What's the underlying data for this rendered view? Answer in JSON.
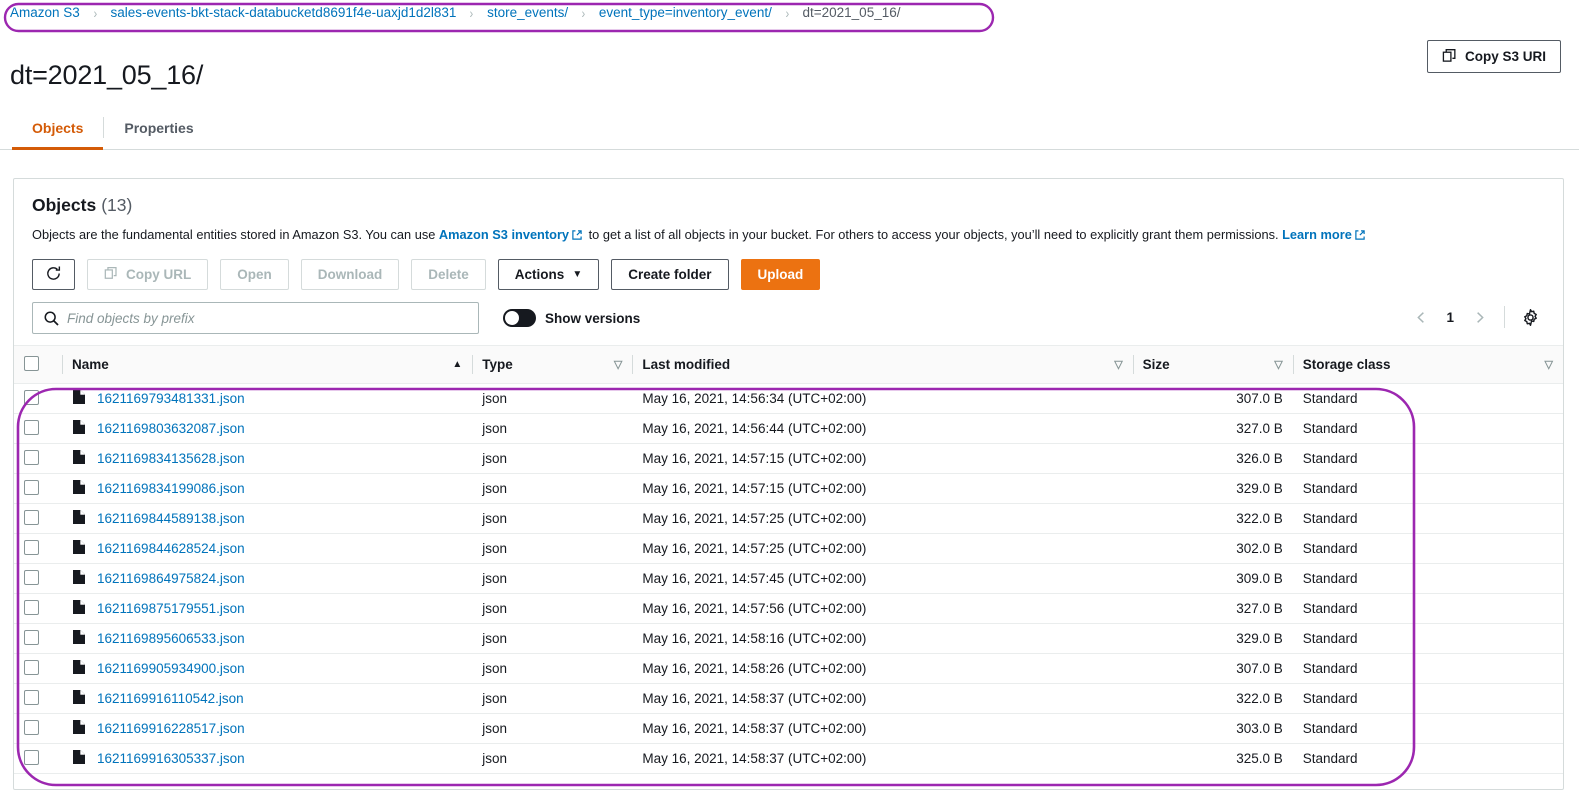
{
  "breadcrumb": {
    "items": [
      {
        "label": "Amazon S3",
        "current": false
      },
      {
        "label": "sales-events-bkt-stack-databucketd8691f4e-uaxjd1d2l831",
        "current": false
      },
      {
        "label": "store_events/",
        "current": false
      },
      {
        "label": "event_type=inventory_event/",
        "current": false
      },
      {
        "label": "dt=2021_05_16/",
        "current": true
      }
    ],
    "separator": "›"
  },
  "header": {
    "title": "dt=2021_05_16/",
    "copy_s3_uri_label": "Copy S3 URI",
    "copy_icon": "copy-icon"
  },
  "tabs": [
    {
      "label": "Objects",
      "active": true
    },
    {
      "label": "Properties",
      "active": false
    }
  ],
  "panel": {
    "title": "Objects",
    "count": "(13)",
    "description_before_link": "Objects are the fundamental entities stored in Amazon S3. You can use ",
    "inventory_link": "Amazon S3 inventory",
    "description_middle": " to get a list of all objects in your bucket. For others to access your objects, you’ll need to explicitly grant them permissions. ",
    "learn_more_link": "Learn more",
    "external_icon": "external-link-icon"
  },
  "toolbar": {
    "refresh_icon": "refresh-icon",
    "copy_url_label": "Copy URL",
    "copy_url_icon": "copy-icon",
    "open_label": "Open",
    "download_label": "Download",
    "delete_label": "Delete",
    "actions_label": "Actions",
    "actions_caret": "▼",
    "create_folder_label": "Create folder",
    "upload_label": "Upload"
  },
  "filter": {
    "search_placeholder": "Find objects by prefix",
    "search_value": "",
    "search_icon": "search-icon",
    "show_versions_label": "Show versions",
    "show_versions_on": false
  },
  "pagination": {
    "prev_icon": "chevron-left-icon",
    "page": "1",
    "next_icon": "chevron-right-icon",
    "settings_icon": "gear-icon"
  },
  "table": {
    "columns": [
      {
        "key": "name",
        "label": "Name",
        "sort": "asc"
      },
      {
        "key": "type",
        "label": "Type",
        "sort": "none"
      },
      {
        "key": "modified",
        "label": "Last modified",
        "sort": "none"
      },
      {
        "key": "size",
        "label": "Size",
        "sort": "none"
      },
      {
        "key": "storage",
        "label": "Storage class",
        "sort": "none"
      }
    ],
    "sort_asc_glyph": "▲",
    "sort_none_glyph": "▽",
    "rows": [
      {
        "name": "1621169793481331.json",
        "type": "json",
        "modified": "May 16, 2021, 14:56:34 (UTC+02:00)",
        "size": "307.0 B",
        "storage": "Standard"
      },
      {
        "name": "1621169803632087.json",
        "type": "json",
        "modified": "May 16, 2021, 14:56:44 (UTC+02:00)",
        "size": "327.0 B",
        "storage": "Standard"
      },
      {
        "name": "1621169834135628.json",
        "type": "json",
        "modified": "May 16, 2021, 14:57:15 (UTC+02:00)",
        "size": "326.0 B",
        "storage": "Standard"
      },
      {
        "name": "1621169834199086.json",
        "type": "json",
        "modified": "May 16, 2021, 14:57:15 (UTC+02:00)",
        "size": "329.0 B",
        "storage": "Standard"
      },
      {
        "name": "1621169844589138.json",
        "type": "json",
        "modified": "May 16, 2021, 14:57:25 (UTC+02:00)",
        "size": "322.0 B",
        "storage": "Standard"
      },
      {
        "name": "1621169844628524.json",
        "type": "json",
        "modified": "May 16, 2021, 14:57:25 (UTC+02:00)",
        "size": "302.0 B",
        "storage": "Standard"
      },
      {
        "name": "1621169864975824.json",
        "type": "json",
        "modified": "May 16, 2021, 14:57:45 (UTC+02:00)",
        "size": "309.0 B",
        "storage": "Standard"
      },
      {
        "name": "1621169875179551.json",
        "type": "json",
        "modified": "May 16, 2021, 14:57:56 (UTC+02:00)",
        "size": "327.0 B",
        "storage": "Standard"
      },
      {
        "name": "1621169895606533.json",
        "type": "json",
        "modified": "May 16, 2021, 14:58:16 (UTC+02:00)",
        "size": "329.0 B",
        "storage": "Standard"
      },
      {
        "name": "1621169905934900.json",
        "type": "json",
        "modified": "May 16, 2021, 14:58:26 (UTC+02:00)",
        "size": "307.0 B",
        "storage": "Standard"
      },
      {
        "name": "1621169916110542.json",
        "type": "json",
        "modified": "May 16, 2021, 14:58:37 (UTC+02:00)",
        "size": "322.0 B",
        "storage": "Standard"
      },
      {
        "name": "1621169916228517.json",
        "type": "json",
        "modified": "May 16, 2021, 14:58:37 (UTC+02:00)",
        "size": "303.0 B",
        "storage": "Standard"
      },
      {
        "name": "1621169916305337.json",
        "type": "json",
        "modified": "May 16, 2021, 14:58:37 (UTC+02:00)",
        "size": "325.0 B",
        "storage": "Standard"
      }
    ]
  },
  "annotations": {
    "color": "#9c27b0",
    "shapes": [
      "breadcrumb-highlight-ellipse",
      "object-list-highlight-ellipse"
    ]
  },
  "colors": {
    "link": "#0073bb",
    "accent_orange": "#ec7211",
    "tab_active": "#d45b07",
    "text": "#16191f",
    "muted": "#545b64",
    "border": "#d5dbdb",
    "annotation_purple": "#9c27b0"
  }
}
